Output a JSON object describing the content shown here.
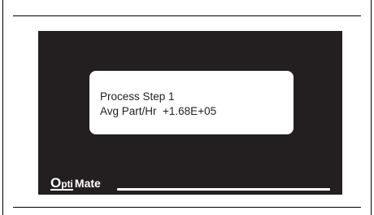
{
  "display": {
    "line1": "Process Step 1",
    "line2": "Avg Part/Hr  +1.68E+05"
  },
  "brand": {
    "opti_first": "O",
    "opti_rest": "pti",
    "mate": "Mate"
  },
  "colors": {
    "panel": "#231f20",
    "lcd_background": "#ffffff",
    "text": "#231f20"
  }
}
